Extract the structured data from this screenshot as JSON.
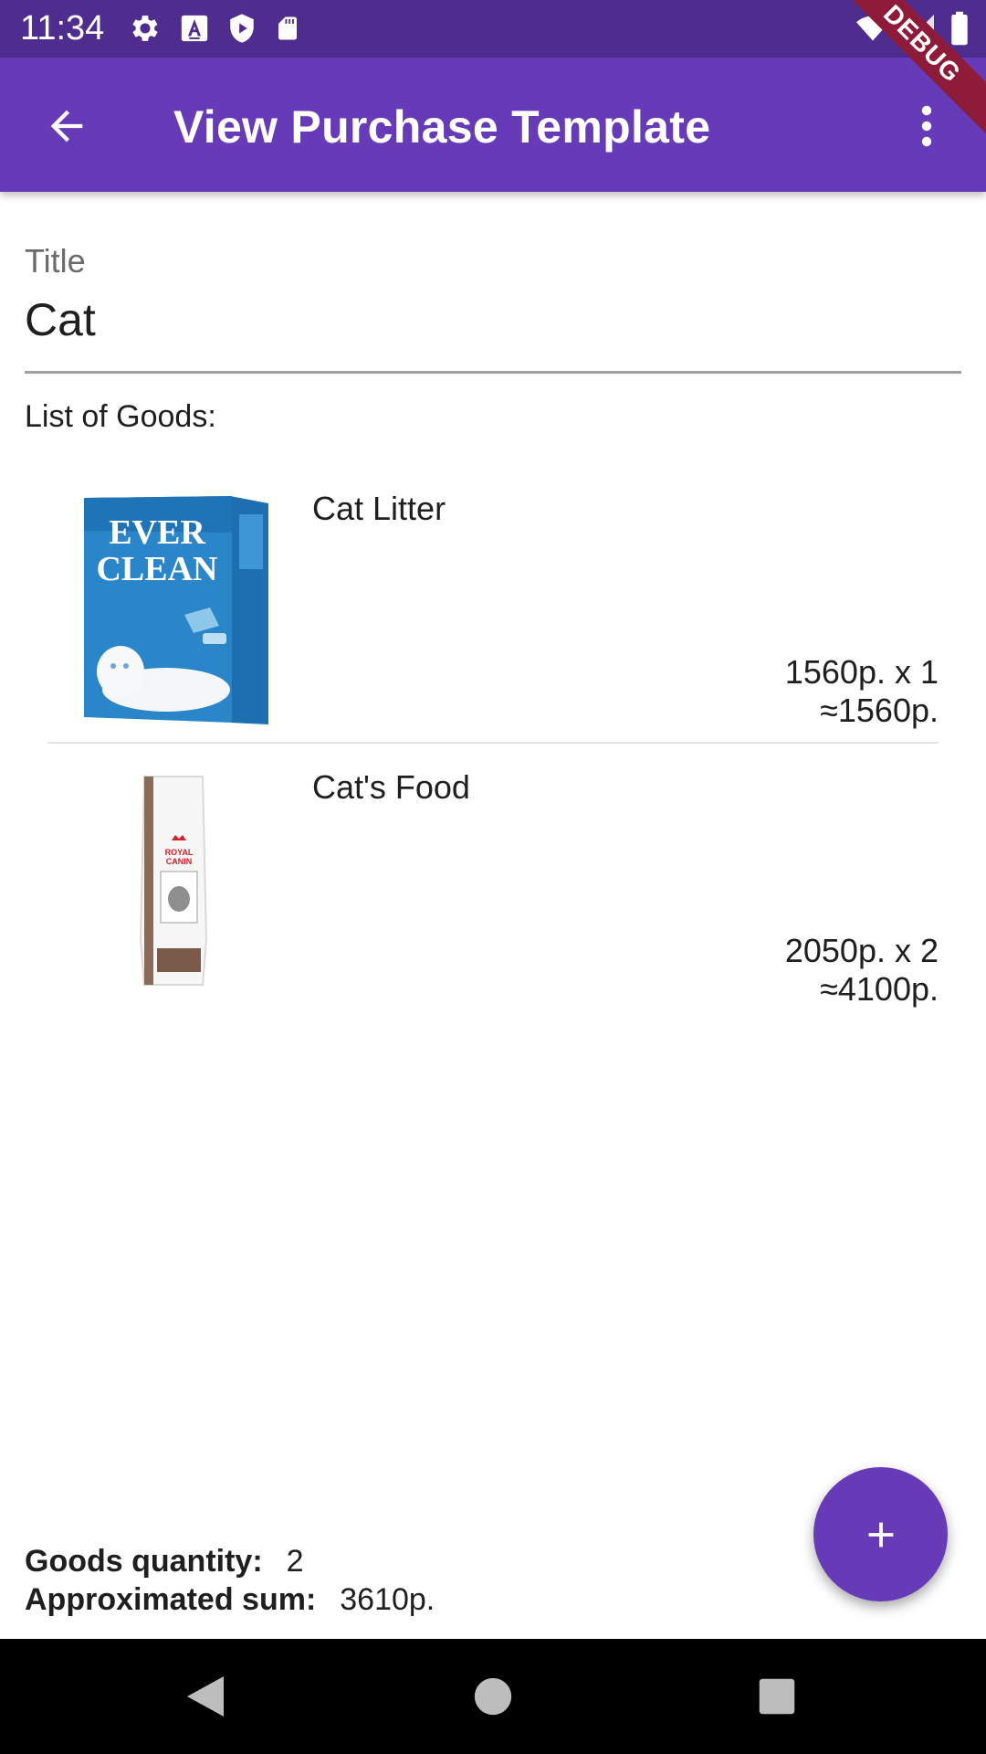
{
  "status_bar": {
    "time": "11:34",
    "icons": [
      "settings-icon",
      "font-icon",
      "shield-icon",
      "sd-card-icon",
      "wifi-icon",
      "signal-icon",
      "battery-icon"
    ]
  },
  "debug_banner": "DEBUG",
  "app_bar": {
    "title": "View Purchase Template",
    "back_icon": "arrow-back-icon",
    "menu_icon": "more-vert-icon"
  },
  "form": {
    "title_label": "Title",
    "title_value": "Cat"
  },
  "goods": {
    "heading": "List of Goods:",
    "items": [
      {
        "name": "Cat Litter",
        "price_line": "1560р. x 1",
        "total_line": "≈1560р.",
        "image_brand": "EVER CLEAN"
      },
      {
        "name": "Cat's Food",
        "price_line": "2050р. x 2",
        "total_line": "≈4100р.",
        "image_brand": "ROYAL CANIN"
      }
    ]
  },
  "summary": {
    "quantity_label": "Goods quantity:",
    "quantity_value": "2",
    "sum_label": "Approximated sum:",
    "sum_value": "3610р."
  },
  "fab": {
    "icon": "plus-icon"
  },
  "colors": {
    "primary": "#673ab7",
    "status_bar": "#4e2d8f",
    "debug": "#8e1b3a"
  }
}
